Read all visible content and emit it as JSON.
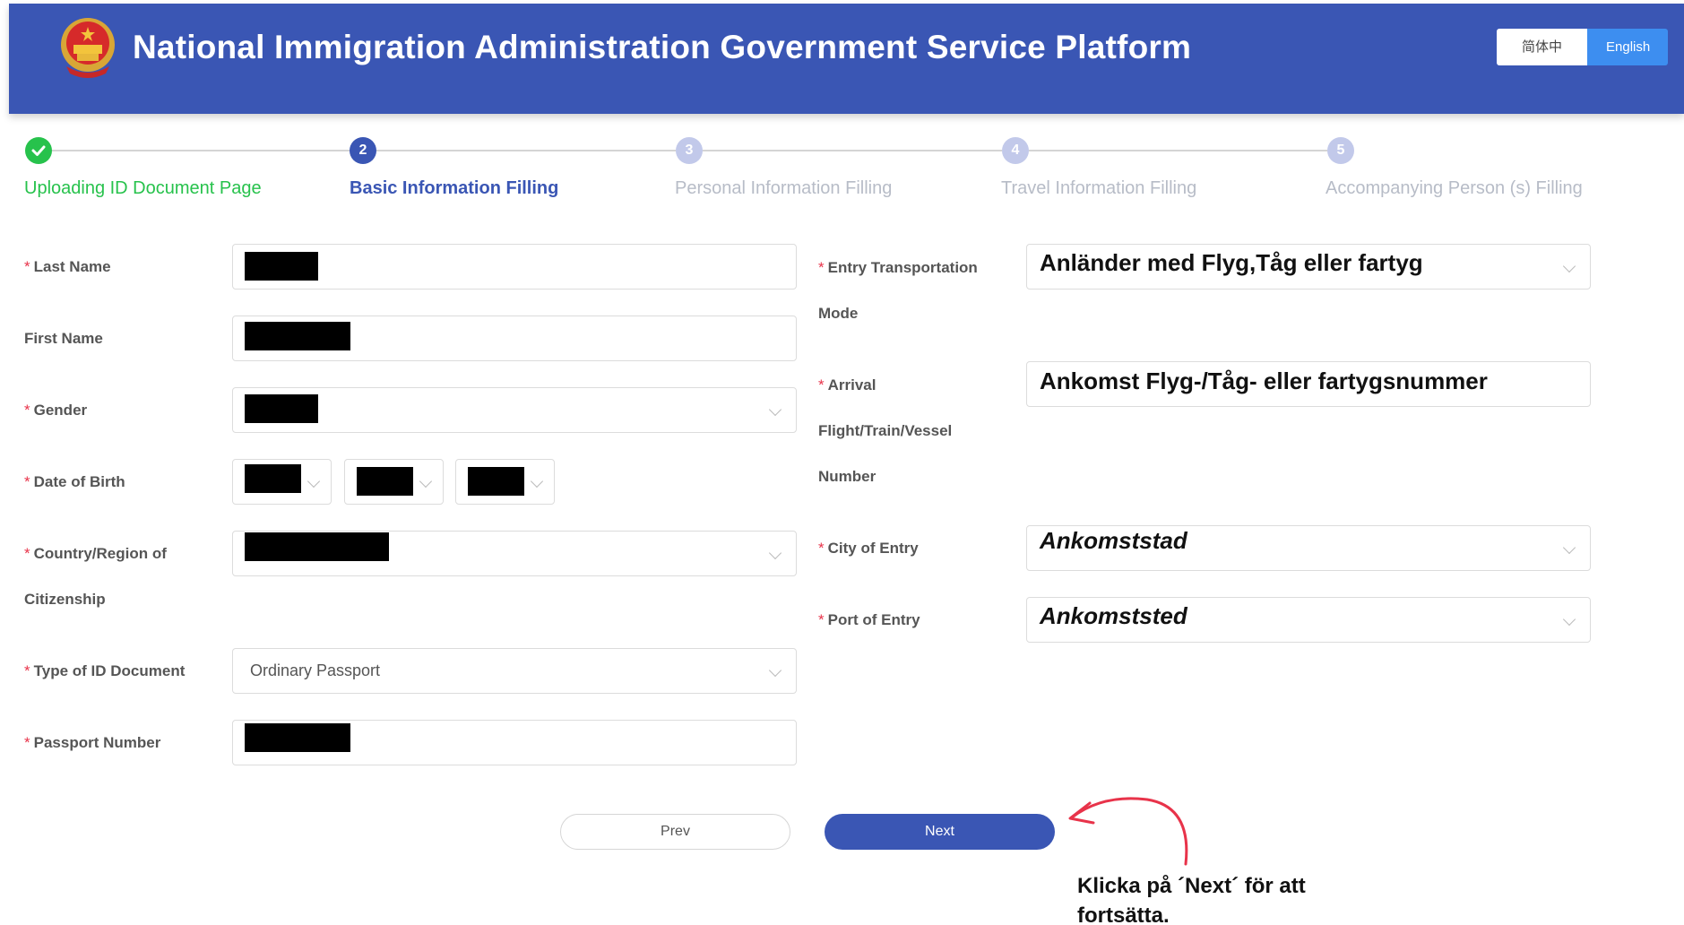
{
  "header": {
    "title": "National Immigration Administration Government Service Platform",
    "emblem_icon": "national-emblem-icon",
    "languages": [
      {
        "label": "简体中文",
        "active": false
      },
      {
        "label": "English",
        "active": true
      }
    ]
  },
  "steps": [
    {
      "number": "",
      "label": "Uploading ID Document Page",
      "state": "done"
    },
    {
      "number": "2",
      "label": "Basic Information Filling",
      "state": "active"
    },
    {
      "number": "3",
      "label": "Personal Information Filling",
      "state": "todo"
    },
    {
      "number": "4",
      "label": "Travel Information Filling",
      "state": "todo"
    },
    {
      "number": "5",
      "label": "Accompanying Person (s) Filling",
      "state": "todo"
    }
  ],
  "form": {
    "left": {
      "last_name": {
        "label": "Last Name",
        "required": "*"
      },
      "first_name": {
        "label": "First Name"
      },
      "gender": {
        "label": "Gender",
        "required": "*"
      },
      "dob": {
        "label": "Date of Birth",
        "required": "*"
      },
      "country": {
        "label_line1": "Country/Region of",
        "label_line2": "Citizenship",
        "required": "*"
      },
      "id_type": {
        "label": "Type of ID Document",
        "required": "*",
        "value": "Ordinary Passport"
      },
      "passport": {
        "label": "Passport Number",
        "required": "*"
      }
    },
    "right": {
      "entry_mode": {
        "label_line1": "Entry Transportation",
        "label_line2": "Mode",
        "required": "*",
        "overlay": "Anländer med Flyg,Tåg eller fartyg"
      },
      "arrival_number": {
        "label_line1": "Arrival",
        "label_line2": "Flight/Train/Vessel",
        "label_line3": "Number",
        "required": "*",
        "overlay": "Ankomst Flyg-/Tåg- eller fartygsnummer"
      },
      "city_of_entry": {
        "label": "City of Entry",
        "required": "*",
        "overlay": "Ankomststad"
      },
      "port_of_entry": {
        "label": "Port of Entry",
        "required": "*",
        "overlay": "Ankomststed"
      }
    }
  },
  "buttons": {
    "prev": "Prev",
    "next": "Next"
  },
  "annotation": {
    "text": "Klicka på ´Next´ för att fortsätta.",
    "arrow_color": "#e8334a"
  },
  "colors": {
    "header": "#3a56b4",
    "done": "#27c24c",
    "active": "#3a56b4",
    "lang_active": "#3d8ef0"
  }
}
